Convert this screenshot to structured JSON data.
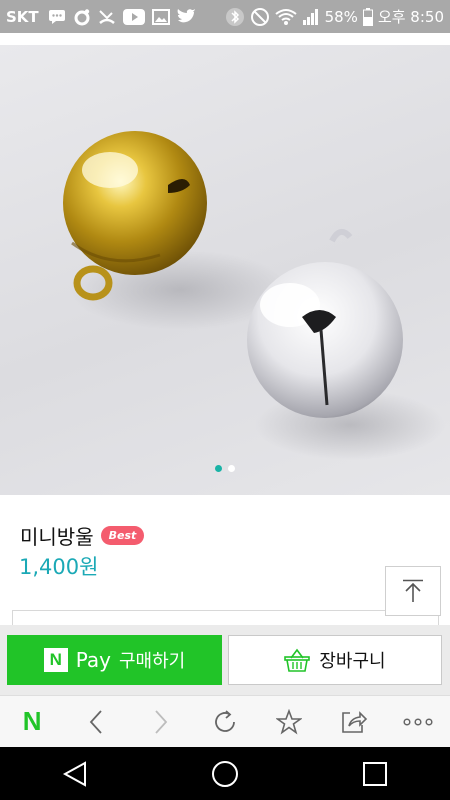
{
  "status_bar": {
    "carrier": "SKT",
    "battery": "58%",
    "time": "오후 8:50",
    "background": "#a9a9a9"
  },
  "product": {
    "title": "미니방울",
    "badge": "Best",
    "price": "1,400원",
    "image_count": 2,
    "active_image": 1,
    "accent": "#1ba9b6",
    "badge_color": "#f45c6e"
  },
  "purchase": {
    "npay_logo": "N",
    "npay_pay": "Pay",
    "npay_buy": "구매하기",
    "npay_color": "#21c428",
    "cart_label": "장바구니"
  },
  "browser_bar": {
    "home_logo": "N",
    "items": [
      "naver-home",
      "back",
      "forward",
      "reload",
      "bookmark",
      "share",
      "more"
    ]
  },
  "nav_bar": {
    "items": [
      "back",
      "home",
      "recent-apps"
    ]
  }
}
